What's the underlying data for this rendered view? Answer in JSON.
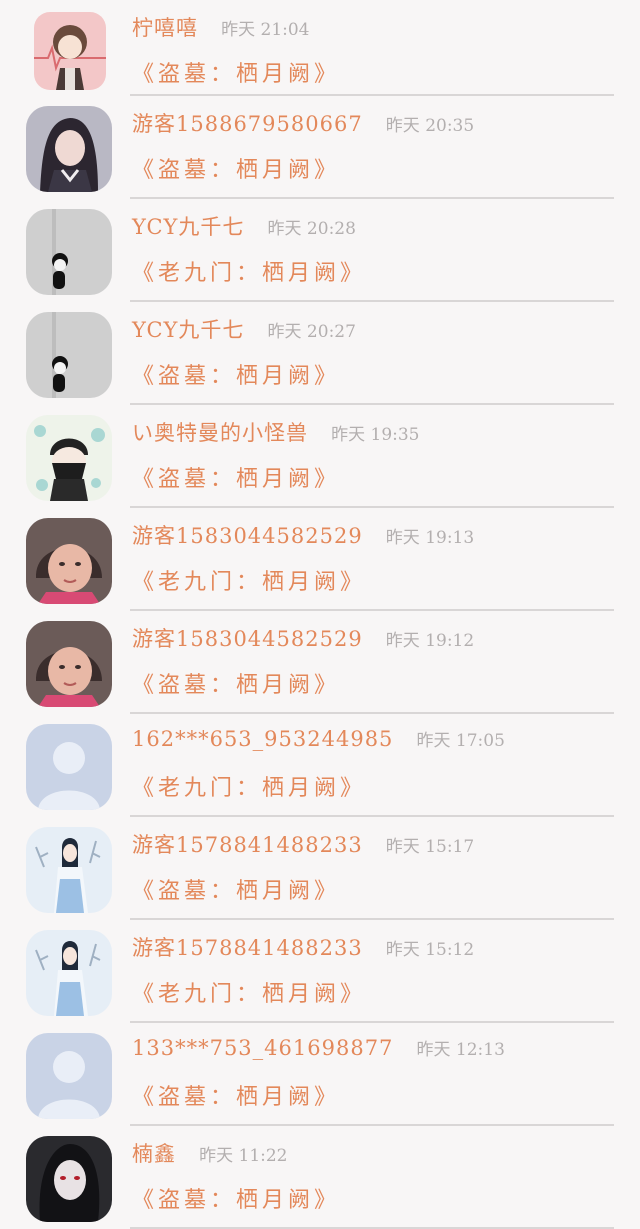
{
  "comments": [
    {
      "name": "柠嘻嘻",
      "time": "昨天 21:04",
      "book": "《盗墓：栖月阙》",
      "avatar": "pink-anime-avatar"
    },
    {
      "name": "游客1588679580667",
      "time": "昨天 20:35",
      "book": "《盗墓：栖月阙》",
      "avatar": "girl-photo-avatar"
    },
    {
      "name": "YCY九千七",
      "time": "昨天 20:28",
      "book": "《老九门：栖月阙》",
      "avatar": "panda-avatar"
    },
    {
      "name": "YCY九千七",
      "time": "昨天 20:27",
      "book": "《盗墓：栖月阙》",
      "avatar": "panda-avatar"
    },
    {
      "name": "い奥特曼的小怪兽",
      "time": "昨天 19:35",
      "book": "《盗墓：栖月阙》",
      "avatar": "masked-boy-avatar"
    },
    {
      "name": "游客1583044582529",
      "time": "昨天 19:13",
      "book": "《老九门：栖月阙》",
      "avatar": "child-photo-avatar"
    },
    {
      "name": "游客1583044582529",
      "time": "昨天 19:12",
      "book": "《盗墓：栖月阙》",
      "avatar": "child-photo-avatar"
    },
    {
      "name": "162***653_953244985",
      "time": "昨天 17:05",
      "book": "《老九门：栖月阙》",
      "avatar": "default-user-avatar"
    },
    {
      "name": "游客1578841488233",
      "time": "昨天 15:17",
      "book": "《盗墓：栖月阙》",
      "avatar": "ancient-costume-avatar"
    },
    {
      "name": "游客1578841488233",
      "time": "昨天 15:12",
      "book": "《老九门：栖月阙》",
      "avatar": "ancient-costume-avatar"
    },
    {
      "name": "133***753_461698877",
      "time": "昨天 12:13",
      "book": "《盗墓：栖月阙》",
      "avatar": "default-user-avatar"
    },
    {
      "name": "楠鑫",
      "time": "昨天 11:22",
      "book": "《盗墓：栖月阙》",
      "avatar": "dark-anime-avatar"
    }
  ],
  "colors": {
    "accent": "#e3885a",
    "muted": "#b3afaf",
    "divider": "#d9d6d6",
    "background": "#f8f6f6"
  }
}
